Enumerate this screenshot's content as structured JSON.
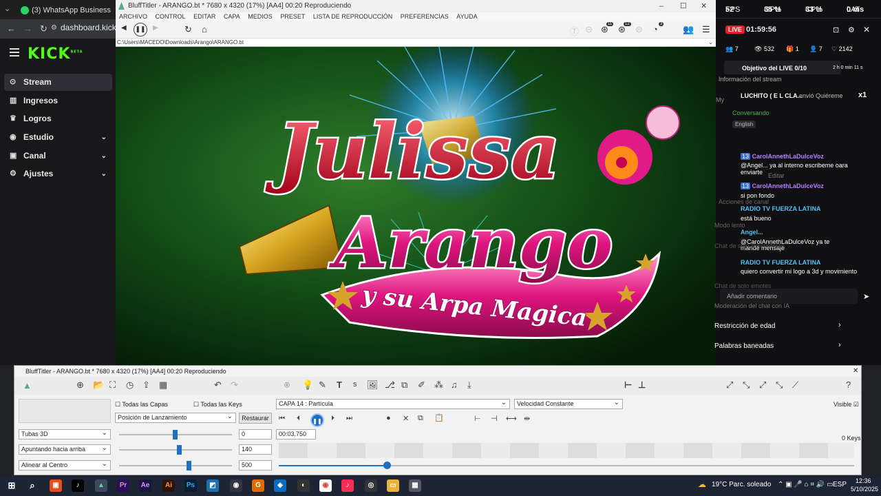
{
  "browser": {
    "tab_title": "(3) WhatsApp Business",
    "url": "dashboard.kick"
  },
  "kick": {
    "logo": "KICK",
    "logo_badge": "BETA",
    "menu": [
      {
        "label": "Stream",
        "icon": "stream-icon"
      },
      {
        "label": "Ingresos",
        "icon": "money-icon"
      },
      {
        "label": "Logros",
        "icon": "trophy-icon"
      },
      {
        "label": "Estudio",
        "icon": "studio-icon"
      },
      {
        "label": "Canal",
        "icon": "channel-icon"
      },
      {
        "label": "Ajustes",
        "icon": "gear-icon"
      }
    ]
  },
  "bluff": {
    "title": "BluffTitler - ARANGO.bt * 7680 x 4320 (17%) [AA4] 00:20 Reproduciendo",
    "menu": [
      "ARCHIVO",
      "CONTROL",
      "EDITAR",
      "CAPA",
      "MEDIOS",
      "PRESET",
      "LISTA DE REPRODUCCIÓN",
      "PREFERENCIAS",
      "AYUDA"
    ],
    "path": "C:\\Users\\MACEDO\\Downloads\\Arango\\ARANGO.bt",
    "badges": [
      "11",
      "12",
      "3"
    ],
    "canvas": {
      "line1": "Julissa",
      "line2": "Arango",
      "line3": "y su Arpa Magica"
    }
  },
  "panel": {
    "title": "BluffTitler - ARANGO.bt * 7680 x 4320 (17%) [AA4] 00:20 Reproduciendo",
    "all_layers": "Todas las Capas",
    "all_keys": "Todas las Keys",
    "layer_select": "CAPA 14      : Partícula",
    "speed_select": "Velocidad Constante",
    "visible": "Visible",
    "launch_select": "Posición de Lanzamiento",
    "restore": "Restaurar",
    "time": "00:03.750",
    "keys": "0 Keys",
    "rows": [
      {
        "select": "Tubas 3D",
        "value": "0"
      },
      {
        "select": "Apuntando hacia arriba",
        "value": "140"
      },
      {
        "select": "Alinear al Centro",
        "value": "500"
      }
    ]
  },
  "stream": {
    "fps_label": "FPS",
    "fps": "52",
    "gpu_label": "GPU",
    "gpu": "35 %",
    "cpu_label": "CPU",
    "cpu": "33 %",
    "lat_label": "LAT",
    "lat": "0 ms",
    "live": "LIVE",
    "uptime": "01:59:56",
    "counts": [
      "7",
      "532",
      "1",
      "7",
      "2142"
    ],
    "goal_label": "Objetivo del LIVE",
    "goal_value": "0/10",
    "goal_time": "2 h 0 min 11 s",
    "info_title": "Información del stream",
    "gift_user": "LUCHITO ( E L CLA...",
    "gift_text": "envió Quiéreme",
    "gift_count": "x1",
    "activity": "Conversando",
    "language": "English",
    "chat": [
      {
        "badge": "13",
        "user": "CarolAnnethLaDulceVoz",
        "text": "@Angel... ya al interno escribeme oara",
        "text2": "enviarte"
      },
      {
        "badge": "13",
        "user": "CarolAnnethLaDulceVoz",
        "text": "si pon fondo"
      },
      {
        "user": "RADIO TV FUERZA LATINA",
        "text": "está bueno"
      },
      {
        "user": "Angel...",
        "text": "@CarolAnnethLaDulceVoz ya te",
        "text2": "mandé mensaje"
      },
      {
        "user": "RADIO TV FUERZA LATINA",
        "text": "quiero convertir mi logo a 3d y movimiento"
      }
    ],
    "comment_placeholder": "Añadir comentario",
    "edit_label": "Editar",
    "channel_actions": "Acciones de canal",
    "slow_mode": "Modo lento",
    "subs_chat": "Chat de solo suscriptores",
    "emotes_chat": "Chat de solo emotes",
    "moderation": "Moderación del chat con IA",
    "age_restriction": "Restricción de edad",
    "banned_words": "Palabras baneadas",
    "dash_m": "My"
  },
  "taskbar": {
    "weather": "19°C  Parc. soleado",
    "lang": "ESP",
    "time": "12:36",
    "date": "5/10/2025"
  },
  "colors": {
    "kick_green": "#53fc18",
    "live_red": "#e91e2b",
    "accent_blue": "#1f6fc2"
  }
}
